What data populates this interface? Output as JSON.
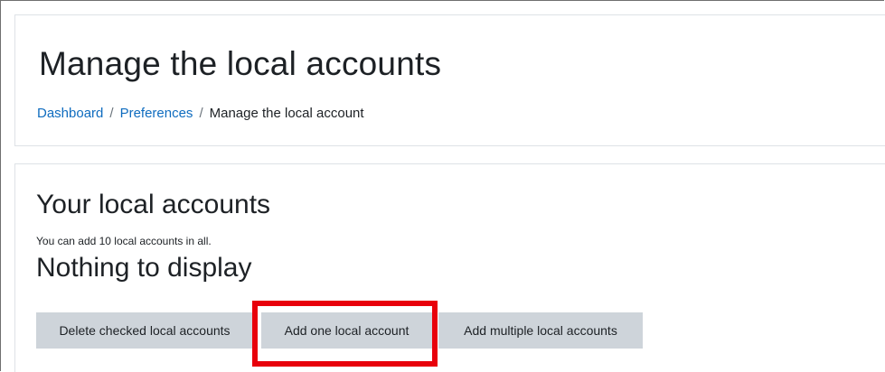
{
  "header": {
    "title": "Manage the local accounts",
    "breadcrumb": {
      "items": [
        "Dashboard",
        "Preferences"
      ],
      "separator": "/",
      "current": "Manage the local account"
    }
  },
  "main": {
    "section_title": "Your local accounts",
    "info": "You can add 10 local accounts in all.",
    "empty_message": "Nothing to display",
    "buttons": {
      "delete_checked": "Delete checked local accounts",
      "add_one": "Add one local account",
      "add_multiple": "Add multiple local accounts"
    }
  },
  "colors": {
    "link": "#0f6cbf",
    "button_bg": "#ced4da",
    "highlight": "#e8000b"
  }
}
